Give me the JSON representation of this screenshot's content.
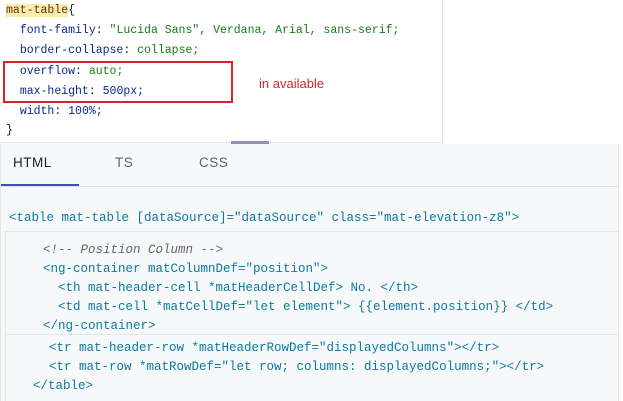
{
  "css_snippet": {
    "selector": "mat-table",
    "open_brace": "{",
    "close_brace": "}",
    "lines": [
      {
        "prop": "font-family",
        "value": "\"Lucida Sans\", Verdana, Arial, sans-serif;"
      },
      {
        "prop": "border-collapse",
        "value": "collapse;"
      },
      {
        "prop": "overflow",
        "value": "auto;"
      },
      {
        "prop": "max-height",
        "value": "500px;"
      },
      {
        "prop": "width",
        "value": "100%;"
      }
    ],
    "annotation": "in available"
  },
  "tabs": [
    "HTML",
    "TS",
    "CSS"
  ],
  "code": {
    "table_open": "<table mat-table [dataSource]=\"dataSource\" class=\"mat-elevation-z8\">",
    "comment": "<!-- Position Column -->",
    "ng_open": "<ng-container matColumnDef=\"position\">",
    "th": "<th mat-header-cell *matHeaderCellDef> No. </th>",
    "td": "<td mat-cell *matCellDef=\"let element\"> {{element.position}} </td>",
    "ng_close": "</ng-container>",
    "tr_header": "<tr mat-header-row *matHeaderRowDef=\"displayedColumns\"></tr>",
    "tr_row": "<tr mat-row *matRowDef=\"let row; columns: displayedColumns;\"></tr>",
    "table_close": "</table>"
  },
  "colors": {
    "accent": "#3f51b5",
    "highlight_red": "#d6262b"
  }
}
